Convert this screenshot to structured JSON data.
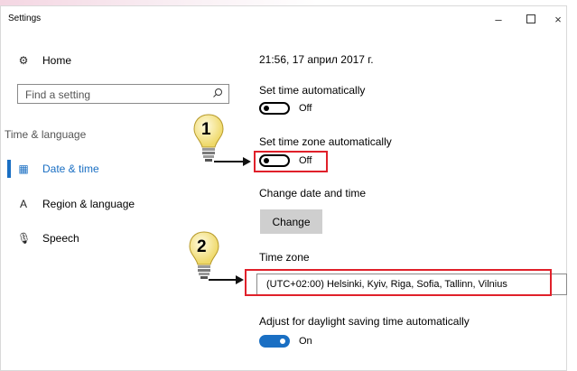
{
  "window": {
    "title": "Settings"
  },
  "window_controls": {
    "minimize": "–",
    "close": "×"
  },
  "sidebar": {
    "home": {
      "icon": "gear-icon",
      "glyph": "⚙",
      "label": "Home"
    },
    "search_placeholder": "Find a setting",
    "section_label": "Time & language",
    "items": [
      {
        "icon": "date-time-icon",
        "glyph": "▦",
        "label": "Date & time",
        "active": true
      },
      {
        "icon": "region-language-icon",
        "glyph": "A",
        "label": "Region & language",
        "active": false
      },
      {
        "icon": "microphone-icon",
        "glyph": "🎙",
        "label": "Speech",
        "active": false
      }
    ]
  },
  "main": {
    "current_datetime": "21:56, 17 април 2017 г.",
    "set_time_auto": {
      "label": "Set time automatically",
      "state": "Off"
    },
    "set_timezone_auto": {
      "label": "Set time zone automatically",
      "state": "Off"
    },
    "change_datetime": {
      "label": "Change date and time",
      "button": "Change"
    },
    "time_zone": {
      "label": "Time zone",
      "value": "(UTC+02:00) Helsinki, Kyiv, Riga, Sofia, Tallinn, Vilnius"
    },
    "daylight": {
      "label": "Adjust for daylight saving time automatically",
      "state": "On"
    }
  },
  "callouts": [
    {
      "number": "1"
    },
    {
      "number": "2"
    }
  ],
  "colors": {
    "accent": "#1a6fc3",
    "highlight": "#e0202a",
    "bulb": "#f5e89a"
  }
}
